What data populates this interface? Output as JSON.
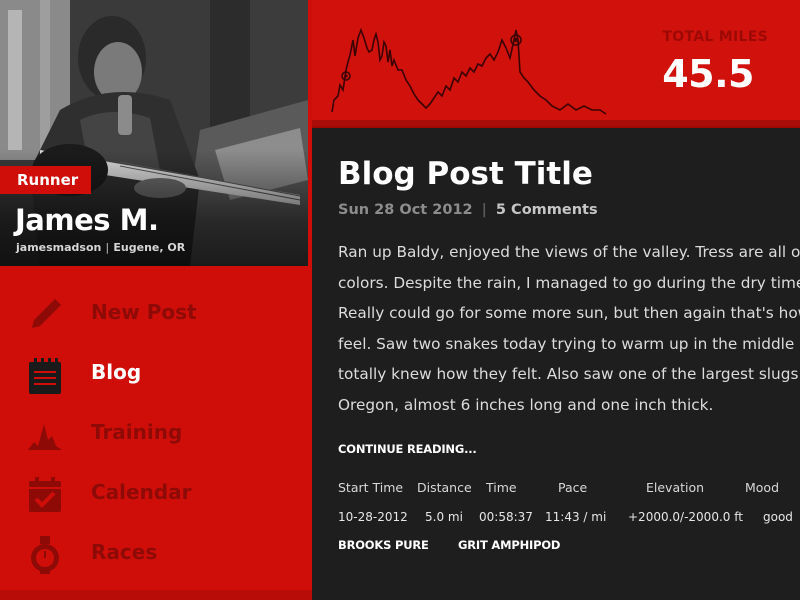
{
  "profile": {
    "role_badge": "Runner",
    "name": "James M.",
    "username": "jamesmadson",
    "location": "Eugene, OR"
  },
  "nav": {
    "items": [
      {
        "label": "New Post",
        "icon": "pencil-icon",
        "active": false
      },
      {
        "label": "Blog",
        "icon": "notepad-icon",
        "active": true
      },
      {
        "label": "Training",
        "icon": "elevation-chart-icon",
        "active": false
      },
      {
        "label": "Calendar",
        "icon": "calendar-check-icon",
        "active": false
      },
      {
        "label": "Races",
        "icon": "stopwatch-icon",
        "active": false
      }
    ]
  },
  "header": {
    "total_label": "TOTAL MILES",
    "total_value": "45.5"
  },
  "post": {
    "title": "Blog Post Title",
    "date": "Sun 28 Oct 2012",
    "comments": "5 Comments",
    "body_lines": [
      "Ran up Baldy, enjoyed the views of the valley. Tress are all o",
      "colors. Despite the rain, I managed to go during the dry time",
      "Really could go for some more sun, but then again that's how",
      "feel. Saw two snakes today trying to warm up in the middle",
      "totally knew how they felt. Also saw one of the largest slugs",
      "Oregon, almost 6 inches long and one inch thick."
    ],
    "continue_label": "CONTINUE READING...",
    "stats": {
      "headers": [
        "Start Time",
        "Distance",
        "Time",
        "Pace",
        "Elevation",
        "Mood"
      ],
      "values": [
        "10-28-2012",
        "5.0 mi",
        "00:58:37",
        "11:43 / mi",
        "+2000.0/-2000.0 ft",
        "good"
      ]
    },
    "gear": [
      "BROOKS PURE",
      "GRIT AMPHIPOD"
    ]
  },
  "colors": {
    "accent_red": "#cf0e0a",
    "nav_inactive": "#8e0a06",
    "content_bg": "#1e1e1e"
  }
}
